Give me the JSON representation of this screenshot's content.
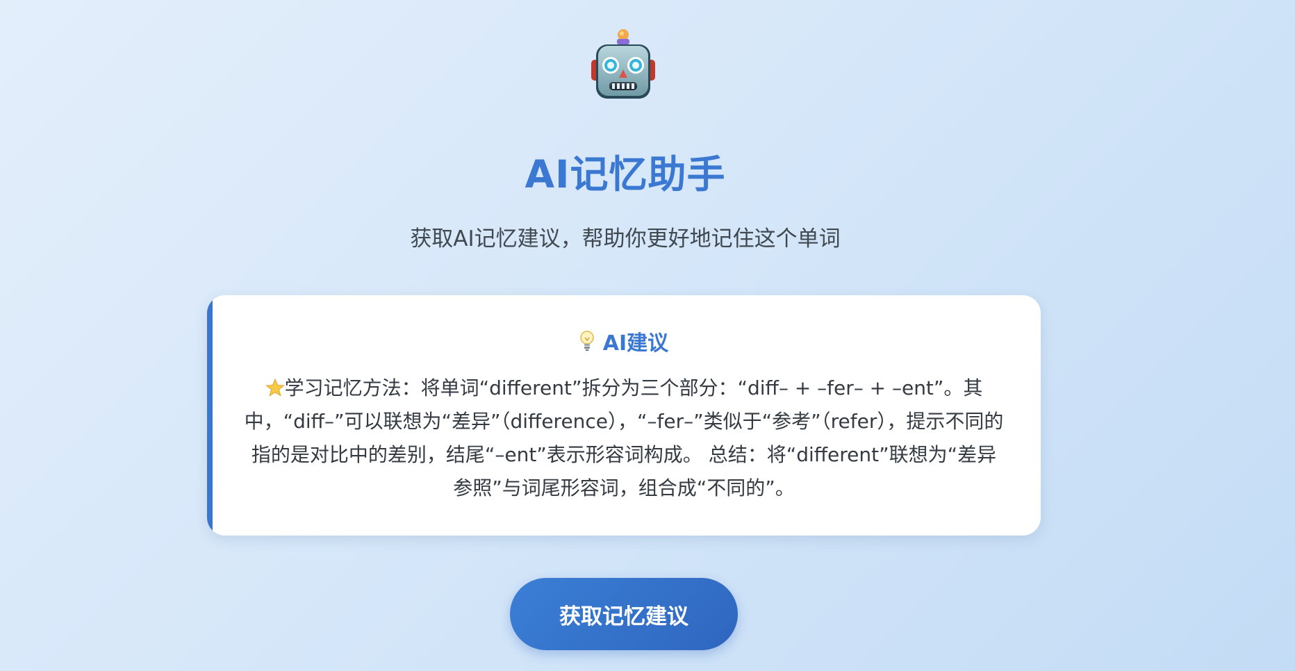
{
  "header": {
    "icon": "robot-icon",
    "title": "AI记忆助手",
    "subtitle": "获取AI记忆建议，帮助你更好地记住这个单词"
  },
  "suggestion_card": {
    "heading_icon": "lightbulb-icon",
    "heading": "AI建议",
    "body_icon": "star-icon",
    "body": "学习记忆方法：将单词“different”拆分为三个部分：“diff– + –fer– + –ent”。其中，“diff–”可以联想为“差异”（difference），“–fer–”类似于“参考”（refer），提示不同的指的是对比中的差别，结尾“–ent”表示形容词构成。 总结：将“different”联想为“差异参照”与词尾形容词，组合成“不同的”。",
    "accent_color": "#3a76cf"
  },
  "action": {
    "button_label": "获取记忆建议"
  },
  "colors": {
    "title": "#3a78d1",
    "button": "#3b7fd6",
    "background": "#d6e7f9"
  }
}
